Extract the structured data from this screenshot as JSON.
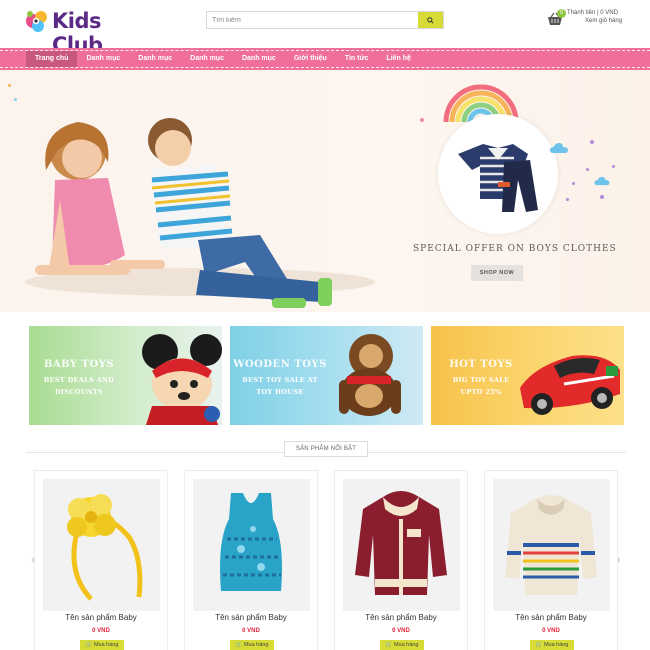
{
  "header": {
    "logo_text": "Kids Club",
    "search_placeholder": "Tìm kiếm",
    "cart": {
      "count": "0",
      "label": "Thành tiền",
      "amount": "0 VND",
      "view_cart": "Xem giỏ hàng"
    }
  },
  "nav": {
    "items": [
      {
        "label": "Trang chủ"
      },
      {
        "label": "Danh mục"
      },
      {
        "label": "Danh mục"
      },
      {
        "label": "Danh mục"
      },
      {
        "label": "Danh mục"
      },
      {
        "label": "Giới thiệu"
      },
      {
        "label": "Tin tức"
      },
      {
        "label": "Liên hệ"
      }
    ]
  },
  "hero": {
    "offer_text": "SPECIAL OFFER ON BOYS CLOTHES",
    "shop_button": "SHOP NOW"
  },
  "banners": [
    {
      "title": "BABY TOYS",
      "subtitle": "BEST DEALS AND\nDISCOUNTS",
      "color_from": "#a9dc92",
      "color_to": "#e8f2ee"
    },
    {
      "title": "WOODEN TOYS",
      "subtitle": "BEST TOY SALE AT\nTOY HOUSE",
      "color_from": "#7fd0e6",
      "color_to": "#cfeaf4"
    },
    {
      "title": "HOT TOYS",
      "subtitle": "BIG TOY SALE\nUPTO 25%",
      "color_from": "#f7c24a",
      "color_to": "#fde08a"
    }
  ],
  "featured": {
    "title": "SẢN PHẨM NỔI BẬT",
    "products": [
      {
        "name": "Tên sản phẩm Baby",
        "price": "0 VND",
        "buy": "Mua hàng",
        "icon": "headband-icon"
      },
      {
        "name": "Tên sản phẩm Baby",
        "price": "0 VND",
        "buy": "Mua hàng",
        "icon": "tank-top-icon"
      },
      {
        "name": "Tên sản phẩm Baby",
        "price": "0 VND",
        "buy": "Mua hàng",
        "icon": "hoodie-icon"
      },
      {
        "name": "Tên sản phẩm Baby",
        "price": "0 VND",
        "buy": "Mua hàng",
        "icon": "sweater-icon"
      }
    ]
  },
  "colors": {
    "nav": "#f06f9a",
    "nav_active": "#c9587e",
    "accent": "#d6dc35",
    "price": "#e0213a",
    "logo": "#5b2a86"
  }
}
